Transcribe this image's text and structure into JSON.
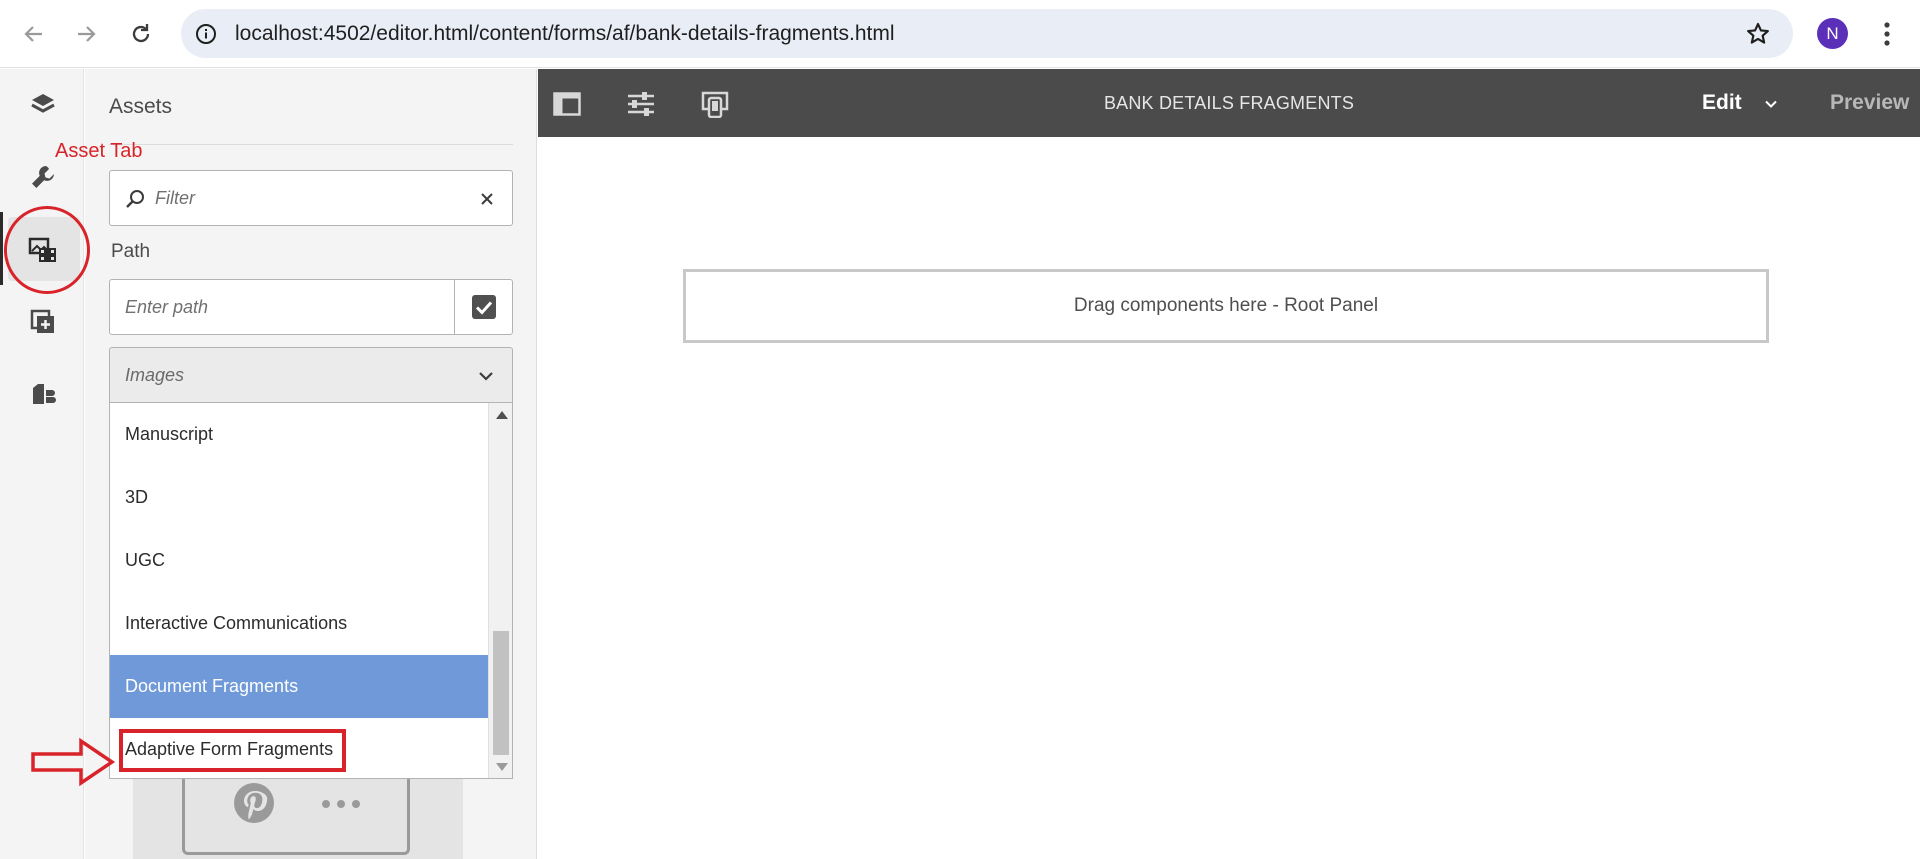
{
  "browser": {
    "url": "localhost:4502/editor.html/content/forms/af/bank-details-fragments.html",
    "profile_initial": "N",
    "profile_color": "#5b2fb8"
  },
  "rail": {
    "items": [
      {
        "icon": "layers-icon"
      },
      {
        "icon": "wrench-icon"
      },
      {
        "icon": "assets-icon",
        "active": true
      },
      {
        "icon": "components-icon"
      },
      {
        "icon": "data-sources-icon"
      }
    ]
  },
  "panel": {
    "title": "Assets",
    "filter_placeholder": "Filter",
    "path_label": "Path",
    "path_placeholder": "Enter path",
    "selected_type": "Images",
    "options": [
      {
        "label": "Manuscript",
        "selected": false
      },
      {
        "label": "3D",
        "selected": false
      },
      {
        "label": "UGC",
        "selected": false
      },
      {
        "label": "Interactive Communications",
        "selected": false
      },
      {
        "label": "Document Fragments",
        "selected": true
      },
      {
        "label": "Adaptive Form Fragments",
        "selected": false
      }
    ],
    "highlight_color": "#6f99d8"
  },
  "editor": {
    "title": "BANK DETAILS FRAGMENTS",
    "mode": "Edit",
    "preview": "Preview",
    "drop_zone": "Drag components here - Root Panel"
  },
  "annotations": {
    "asset_tab_label": "Asset Tab",
    "color": "#d9232a"
  }
}
